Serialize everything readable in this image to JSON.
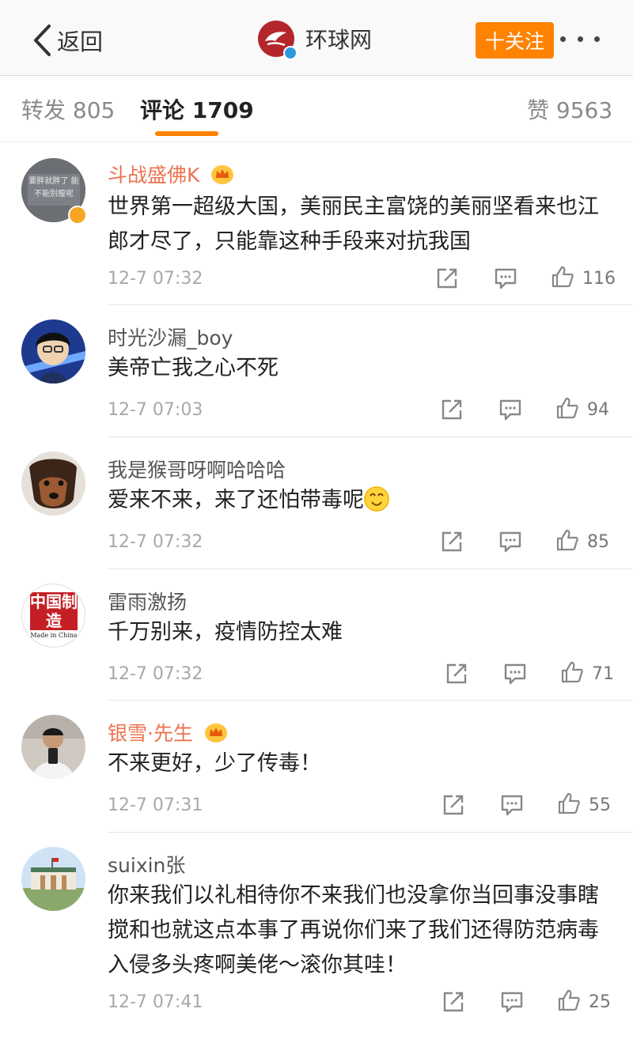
{
  "header": {
    "back_label": "返回",
    "account_name": "环球网",
    "follow_label": "十关注"
  },
  "tabs": {
    "reposts": "转发 805",
    "comments": "评论 1709",
    "likes": "赞 9563"
  },
  "comments": [
    {
      "user": "斗战盛佛K",
      "text": "世界第一超级大国，美丽民主富饶的美丽坚看来也江郎才尽了，只能靠这种手段来对抗我国",
      "time": "12-7 07:32",
      "likes": "116",
      "avatar_text": "要胖就胖了 能不能别瘦呢"
    },
    {
      "user": "时光沙漏_boy",
      "text": "美帝亡我之心不死",
      "time": "12-7 07:03",
      "likes": "94"
    },
    {
      "user": "我是猴哥呀啊哈哈哈",
      "text": "爱来不来，来了还怕带毒呢",
      "time": "12-7 07:32",
      "likes": "85"
    },
    {
      "user": "雷雨激扬",
      "text": "千万别来，疫情防控太难",
      "time": "12-7 07:32",
      "likes": "71",
      "avatar_text": "中国制造",
      "avatar_sub": "Made in China"
    },
    {
      "user": "银雪·先生",
      "text": "不来更好，少了传毒！",
      "time": "12-7 07:31",
      "likes": "55"
    },
    {
      "user": "suixin张",
      "text": "你来我们以礼相待你不来我们也没拿你当回事没事瞎搅和也就这点本事了再说你们来了我们还得防范病毒入侵多头疼啊美佬～滚你其哇！",
      "time": "12-7 07:41",
      "likes": "25"
    }
  ],
  "colors": {
    "accent": "#ff8200",
    "vip_name": "#eb7350",
    "secondary_text": "#a8a8a8"
  }
}
